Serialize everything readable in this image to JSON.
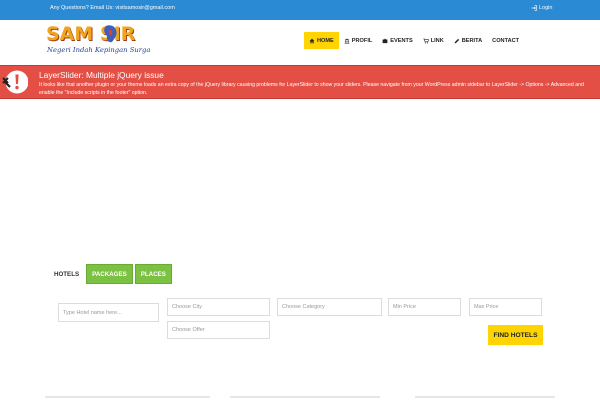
{
  "topbar": {
    "contact_text": "Any Questions? Email Us: visitsamosir@gmail.com",
    "login_label": "Login",
    "color": "#2a8ad4"
  },
  "logo": {
    "wordmark": "SAM  SIR",
    "tagline": "Negeri Indah Kepingan Surga",
    "brand_color": "#f1a41d",
    "tagline_color": "#253c96"
  },
  "nav": {
    "items": [
      {
        "label": "HOME",
        "icon": "home-icon",
        "active": true
      },
      {
        "label": "PROFIL",
        "icon": "bank-icon",
        "active": false
      },
      {
        "label": "EVENTS",
        "icon": "briefcase-icon",
        "active": false
      },
      {
        "label": "LINK",
        "icon": "cart-icon",
        "active": false
      },
      {
        "label": "BERITA",
        "icon": "pencil-icon",
        "active": false
      },
      {
        "label": "CONTACT",
        "icon": "",
        "active": false
      }
    ],
    "active_color": "#ffd400"
  },
  "alert": {
    "title": "LayerSlider: Multiple jQuery issue",
    "message": "It looks like that another plugin or your theme loads an extra copy of the jQuery library causing problems for LayerSlider to show your sliders. Please navigate from your WordPress admin sidebar to LayerSlider -> Options -> Advanced and enable the \"Include scripts in the footer\" option.",
    "color": "#e34f45"
  },
  "tabs": [
    {
      "label": "HOTELS",
      "style": "plain"
    },
    {
      "label": "PACKAGES",
      "style": "green"
    },
    {
      "label": "PLACES",
      "style": "green"
    }
  ],
  "search": {
    "hotel_name_placeholder": "Type Hotel name here...",
    "city_placeholder": "Choose City",
    "category_placeholder": "Choose Category",
    "min_price_placeholder": "Min Price",
    "max_price_placeholder": "Max Price",
    "offer_placeholder": "Choose Offer",
    "find_button_label": "FIND HOTELS",
    "accent_color": "#ffd400"
  }
}
